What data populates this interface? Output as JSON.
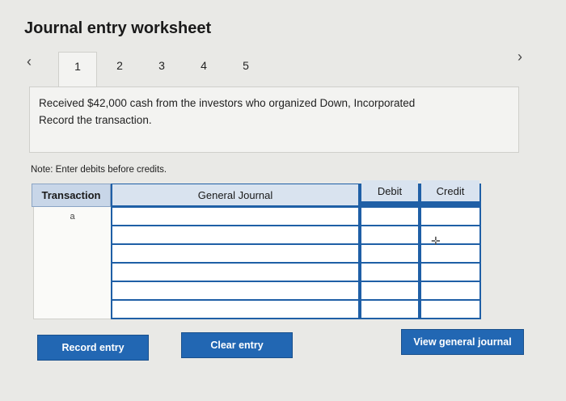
{
  "header": {
    "title": "Journal entry worksheet"
  },
  "nav": {
    "prev_icon": "chevron-left-icon",
    "next_icon": "chevron-right-icon",
    "tabs": [
      {
        "label": "1",
        "active": true
      },
      {
        "label": "2",
        "active": false
      },
      {
        "label": "3",
        "active": false
      },
      {
        "label": "4",
        "active": false
      },
      {
        "label": "5",
        "active": false
      }
    ]
  },
  "problem": {
    "line1": "Received $42,000 cash from the investors who organized Down, Incorporated",
    "line2": "Record the transaction."
  },
  "note": "Note: Enter debits before credits.",
  "table": {
    "headers": {
      "transaction": "Transaction",
      "general_journal": "General Journal",
      "debit": "Debit",
      "credit": "Credit"
    },
    "rows": [
      {
        "transaction": "a",
        "account": "",
        "debit": "",
        "credit": ""
      },
      {
        "transaction": "",
        "account": "",
        "debit": "",
        "credit": ""
      },
      {
        "transaction": "",
        "account": "",
        "debit": "",
        "credit": ""
      },
      {
        "transaction": "",
        "account": "",
        "debit": "",
        "credit": ""
      },
      {
        "transaction": "",
        "account": "",
        "debit": "",
        "credit": ""
      },
      {
        "transaction": "",
        "account": "",
        "debit": "",
        "credit": ""
      }
    ]
  },
  "buttons": {
    "record": "Record entry",
    "clear": "Clear entry",
    "view": "View general journal"
  },
  "colors": {
    "accent": "#2267b3",
    "header_blue": "#1f5fa6",
    "background": "#e9e9e6"
  }
}
